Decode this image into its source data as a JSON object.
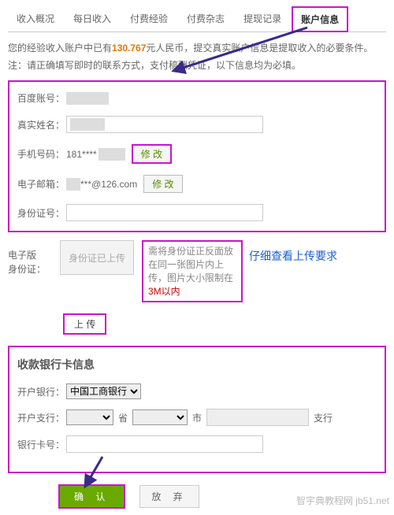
{
  "tabs": [
    "收入概况",
    "每日收入",
    "付费经验",
    "付费杂志",
    "提现记录",
    "账户信息"
  ],
  "active_tab": 5,
  "notice": {
    "p1a": "您的经验收入账户中已有",
    "amount": "130.767",
    "p1b": "元人民币，提交真实账户信息是提取收入的必要条件。",
    "p2": "注：请正确填写即时的联系方式，支付稿酬凭证，以下信息均为必填。"
  },
  "fields": {
    "baidu_label": "百度账号：",
    "name_label": "真实姓名：",
    "phone_label": "手机号码：",
    "phone_value": "181****",
    "modify": "修 改",
    "email_label": "电子邮箱：",
    "email_value": "***@126.com",
    "id_label": "身份证号："
  },
  "upload": {
    "label1": "电子版",
    "label2": "身份证：",
    "preview_text": "身份证已上传",
    "tip_a": "需将身份证正反面放在同一张图片内上传，图片大小限制在",
    "tip_b": "3M以内",
    "note": "仔细查看上传要求",
    "button": "上 传"
  },
  "bank": {
    "title": "收款银行卡信息",
    "open_bank_label": "开户银行：",
    "open_bank_value": "中国工商银行",
    "branch_label": "开户支行：",
    "prov": "省",
    "city": "市",
    "branch_suffix": "支行",
    "card_label": "银行卡号："
  },
  "actions": {
    "confirm": "确 认",
    "cancel": "放 弃"
  },
  "watermark": "智宇典教程网 jb51.net"
}
